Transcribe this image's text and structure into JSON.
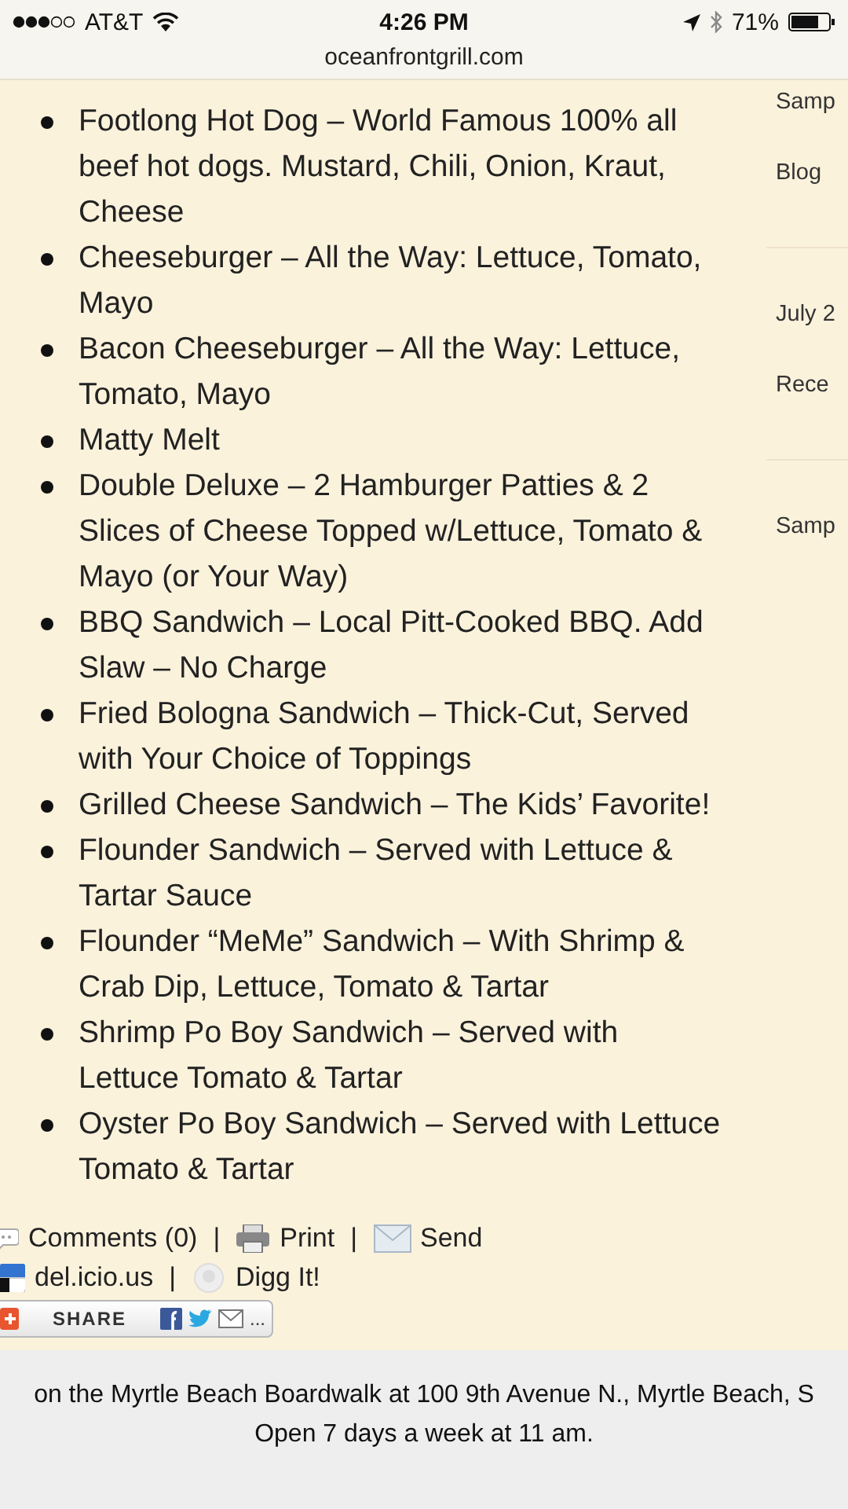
{
  "status_bar": {
    "carrier": "AT&T",
    "time": "4:26 PM",
    "battery": "71%"
  },
  "url": "oceanfrontgrill.com",
  "menu_items": [
    "Footlong Hot Dog – World Famous 100% all beef hot dogs. Mustard, Chili, Onion, Kraut, Cheese",
    "Cheeseburger – All the Way: Lettuce, Tomato, Mayo",
    "Bacon Cheeseburger – All the Way: Lettuce, Tomato, Mayo",
    "Matty Melt",
    "Double Deluxe – 2 Hamburger Patties & 2 Slices of Cheese Topped w/Lettuce, Tomato & Mayo (or Your Way)",
    "BBQ Sandwich – Local Pitt-Cooked BBQ. Add Slaw – No Charge",
    "Fried Bologna Sandwich – Thick-Cut, Served with Your Choice of Toppings",
    "Grilled Cheese Sandwich – The Kids’ Favorite!",
    "Flounder Sandwich – Served with Lettuce & Tartar Sauce",
    "Flounder “MeMe” Sandwich – With Shrimp & Crab Dip, Lettuce, Tomato & Tartar",
    "Shrimp Po Boy Sandwich – Served with Lettuce Tomato & Tartar",
    "Oyster Po Boy Sandwich – Served with Lettuce Tomato & Tartar"
  ],
  "sidebar": [
    [
      "Samp",
      "Blog"
    ],
    [
      "July 2",
      "Rece"
    ],
    [
      "Samp"
    ]
  ],
  "post_links": [
    [
      {
        "kind": "comments",
        "label": "Comments (0)"
      },
      {
        "kind": "print",
        "label": "Print",
        "separator": "|"
      },
      {
        "kind": "send",
        "label": "Send",
        "separator": "|"
      }
    ],
    [
      {
        "kind": "delicious",
        "label": "del.icio.us"
      },
      {
        "kind": "digg",
        "label": "Digg It!",
        "separator": "|"
      }
    ]
  ],
  "share_button": {
    "label": "SHARE",
    "more": "..."
  },
  "footer": [
    "on the Myrtle Beach Boardwalk at 100 9th Avenue N., Myrtle Beach, S",
    "Open 7 days a week at 11 am."
  ]
}
